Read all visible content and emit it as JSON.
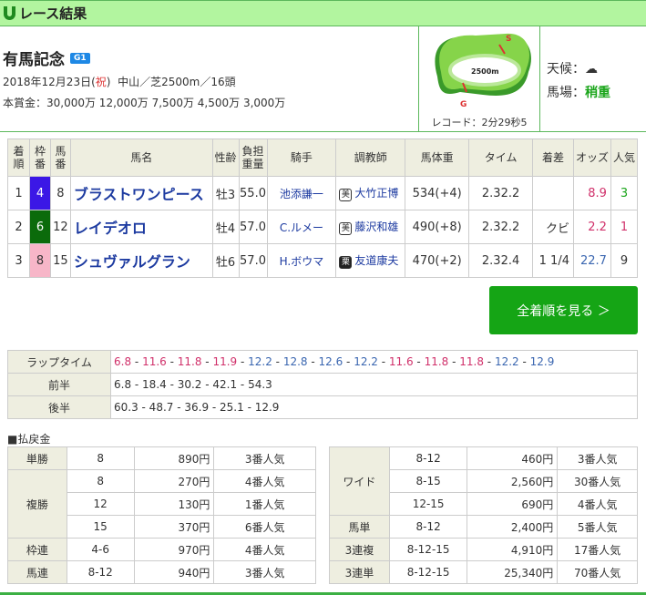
{
  "header": {
    "title": "レース結果"
  },
  "race": {
    "name": "有馬記念",
    "grade": "G1",
    "date": "2018年12月23日(",
    "holiday": "祝",
    "date_end": ")",
    "course": "中山／芝2500m／16頭",
    "prize": "本賞金：30,000万 12,000万 7,500万 4,500万 3,000万"
  },
  "track": {
    "distance": "2500m",
    "start": "S",
    "goal": "G",
    "record": "レコード：2分29秒5"
  },
  "conditions": {
    "weather_label": "天候：",
    "weather_icon": "cloudy-icon",
    "baba_label": "馬場：",
    "baba": "稍重"
  },
  "results": {
    "headers": [
      "着順",
      "枠番",
      "馬番",
      "馬名",
      "性齢",
      "負担重量",
      "騎手",
      "調教師",
      "馬体重",
      "タイム",
      "着差",
      "オッズ",
      "人気"
    ],
    "rows": [
      {
        "pos": "1",
        "waku": "4",
        "waku_color": "#3b17e6",
        "waku_text": "#fff",
        "num": "8",
        "name": "ブラストワンピース",
        "sexage": "牡3",
        "weight": "55.0",
        "jockey": "池添謙一",
        "stable": "美",
        "stable_dark": false,
        "trainer": "大竹正博",
        "body": "534(+4)",
        "time": "2.32.2",
        "margin": "",
        "odds": "8.9",
        "odds_color": "#d0306a",
        "pop": "3",
        "pop_color": "#1aa51a"
      },
      {
        "pos": "2",
        "waku": "6",
        "waku_color": "#0b6b0b",
        "waku_text": "#fff",
        "num": "12",
        "name": "レイデオロ",
        "sexage": "牡4",
        "weight": "57.0",
        "jockey": "C.ルメー",
        "stable": "美",
        "stable_dark": false,
        "trainer": "藤沢和雄",
        "body": "490(+8)",
        "time": "2.32.2",
        "margin": "クビ",
        "odds": "2.2",
        "odds_color": "#d0306a",
        "pop": "1",
        "pop_color": "#d0306a"
      },
      {
        "pos": "3",
        "waku": "8",
        "waku_color": "#f7b6c8",
        "waku_text": "#333",
        "num": "15",
        "name": "シュヴァルグラン",
        "sexage": "牡6",
        "weight": "57.0",
        "jockey": "H.ボウマ",
        "stable": "栗",
        "stable_dark": true,
        "trainer": "友道康夫",
        "body": "470(+2)",
        "time": "2.32.4",
        "margin": "1 1/4",
        "odds": "22.7",
        "odds_color": "#3a66b0",
        "pop": "9",
        "pop_color": "#333"
      }
    ]
  },
  "all_results_button": "全着順を見る ＞",
  "laps": {
    "label": "ラップタイム",
    "values": [
      "6.8",
      "11.6",
      "11.8",
      "11.9",
      "12.2",
      "12.8",
      "12.6",
      "12.2",
      "11.6",
      "11.8",
      "11.8",
      "12.2",
      "12.9"
    ],
    "fast_color": "#d0306a",
    "slow_color": "#3a66b0",
    "first_label": "前半",
    "first": "6.8 - 18.4 - 30.2 - 42.1 - 54.3",
    "second_label": "後半",
    "second": "60.3 - 48.7 - 36.9 - 25.1 - 12.9"
  },
  "payouts": {
    "title": "■払戻金",
    "left": [
      {
        "type": "単勝",
        "rows": [
          [
            "8",
            "890円",
            "3番人気"
          ]
        ]
      },
      {
        "type": "複勝",
        "rows": [
          [
            "8",
            "270円",
            "4番人気"
          ],
          [
            "12",
            "130円",
            "1番人気"
          ],
          [
            "15",
            "370円",
            "6番人気"
          ]
        ]
      },
      {
        "type": "枠連",
        "rows": [
          [
            "4-6",
            "970円",
            "4番人気"
          ]
        ]
      },
      {
        "type": "馬連",
        "rows": [
          [
            "8-12",
            "940円",
            "3番人気"
          ]
        ]
      }
    ],
    "right": [
      {
        "type": "ワイド",
        "rows": [
          [
            "8-12",
            "460円",
            "3番人気"
          ],
          [
            "8-15",
            "2,560円",
            "30番人気"
          ],
          [
            "12-15",
            "690円",
            "4番人気"
          ]
        ]
      },
      {
        "type": "馬単",
        "rows": [
          [
            "8-12",
            "2,400円",
            "5番人気"
          ]
        ]
      },
      {
        "type": "3連複",
        "rows": [
          [
            "8-12-15",
            "4,910円",
            "17番人気"
          ]
        ]
      },
      {
        "type": "3連単",
        "rows": [
          [
            "8-12-15",
            "25,340円",
            "70番人気"
          ]
        ]
      }
    ]
  }
}
